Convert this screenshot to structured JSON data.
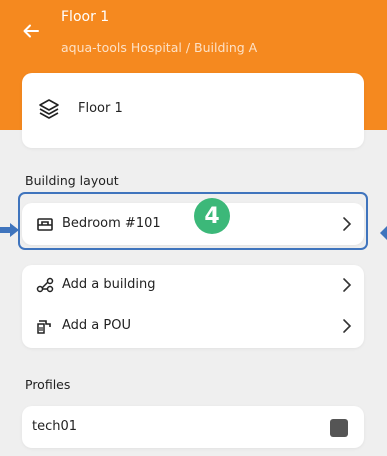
{
  "header": {
    "title": "Floor 1",
    "subtitle": "aqua-tools Hospital / Building A",
    "accent_color": "#f5891f",
    "back_icon": "arrow-left-icon"
  },
  "floor_card": {
    "label": "Floor 1",
    "icon": "layers-icon"
  },
  "building_layout": {
    "section_title": "Building layout",
    "rooms": [
      {
        "label": "Bedroom #101",
        "icon": "bed-icon"
      }
    ]
  },
  "actions": [
    {
      "label": "Add a building",
      "icon": "hierarchy-icon"
    },
    {
      "label": "Add a POU",
      "icon": "faucet-icon"
    }
  ],
  "profiles": {
    "section_title": "Profiles",
    "items": [
      {
        "label": "tech01",
        "checked": true
      }
    ]
  },
  "annotation": {
    "badge_number": "4",
    "badge_color": "#3cb879",
    "highlight_color": "#3f74bd"
  }
}
